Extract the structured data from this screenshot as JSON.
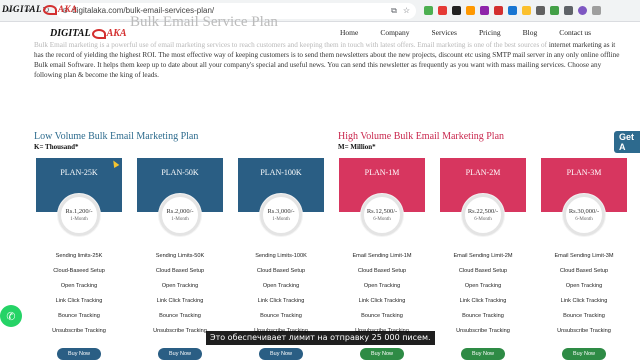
{
  "browser": {
    "url": "digitalaka.com/bulk-email-services-plan/"
  },
  "logo": {
    "text_a": "DIGITAL",
    "text_b": "AKA"
  },
  "site_nav": [
    "Home",
    "Company",
    "Services",
    "Pricing",
    "Blog",
    "Contact us"
  ],
  "page": {
    "heading": "Bulk Email Service Plan",
    "intro_faded": "Bulk Email marketing is a powerful use of email marketing services to reach customers and keeping them in touch with latest offers. Email marketing is one of the best sources of",
    "intro": "internet marketing as it has the record of yielding the highest ROI. The most effective way of keeping customers is to send them newsletters about the new projects, discount etc using SMTP mail server in any only online offline Bulk email Software. It helps them keep up to date about all your company's special and useful news. You can send this newsletter as frequently as you want with mass mailing services. Choose any following plan & become the king of leads."
  },
  "sections": {
    "low": {
      "title": "Low Volume Bulk Email Marketing Plan",
      "sub": "K= Thousand*"
    },
    "high": {
      "title": "High Volume Bulk Email Marketing Plan",
      "sub": "M= Million*"
    },
    "get_button": "Get A"
  },
  "plans": [
    {
      "name": "PLAN-25K",
      "price": "Rs.1,200/-",
      "period": "1-Month",
      "features": [
        "Sending limits-25K",
        "Cloud-Baseed Setup",
        "Open Tracking",
        "Link Click Tracking",
        "Bounce Tracking",
        "Unsubscribe Tracking"
      ],
      "buy": "Buy Now"
    },
    {
      "name": "PLAN-50K",
      "price": "Rs.2,000/-",
      "period": "1-Month",
      "features": [
        "Sending Limits-50K",
        "Cloud Based Setup",
        "Open Tracking",
        "Link Click Tracking",
        "Bounce Tracking",
        "Unsubscribe Tracking"
      ],
      "buy": "Buy Now"
    },
    {
      "name": "PLAN-100K",
      "price": "Rs.3,000/-",
      "period": "1-Month",
      "features": [
        "Sending Limits-100K",
        "Cloud Based Setup",
        "Open Tracking",
        "Link Click Tracking",
        "Bounce Tracking",
        "Unsubscribe Tracking"
      ],
      "buy": "Buy Now"
    },
    {
      "name": "PLAN-1M",
      "price": "Rs.12,500/-",
      "period": "6-Month",
      "features": [
        "Email Sending Limit-1M",
        "Cloud Based Setup",
        "Open Tracking",
        "Link Click Tracking",
        "Bounce Tracking",
        "Unsubscribe Tracking"
      ],
      "buy": "Buy Now"
    },
    {
      "name": "PLAN-2M",
      "price": "Rs.22,500/-",
      "period": "6-Month",
      "features": [
        "Email Sending Limit-2M",
        "Cloud Based Setup",
        "Open Tracking",
        "Link Click Tracking",
        "Bounce Tracking",
        "Unsubscribe Tracking"
      ],
      "buy": "Buy Now"
    },
    {
      "name": "PLAN-3M",
      "price": "Rs.30,000/-",
      "period": "6-Month",
      "features": [
        "Email Sending Limit-3M",
        "Cloud Based Setup",
        "Open Tracking",
        "Link Click Tracking",
        "Bounce Tracking",
        "Unsubscribe Tracking"
      ],
      "buy": "Buy Now"
    }
  ],
  "caption": "Это обеспечивает лимит на отправку 25 000 писем.",
  "colors": {
    "low_accent": "#2a5e84",
    "high_accent": "#d7365f",
    "buy_high": "#2e8b45"
  }
}
